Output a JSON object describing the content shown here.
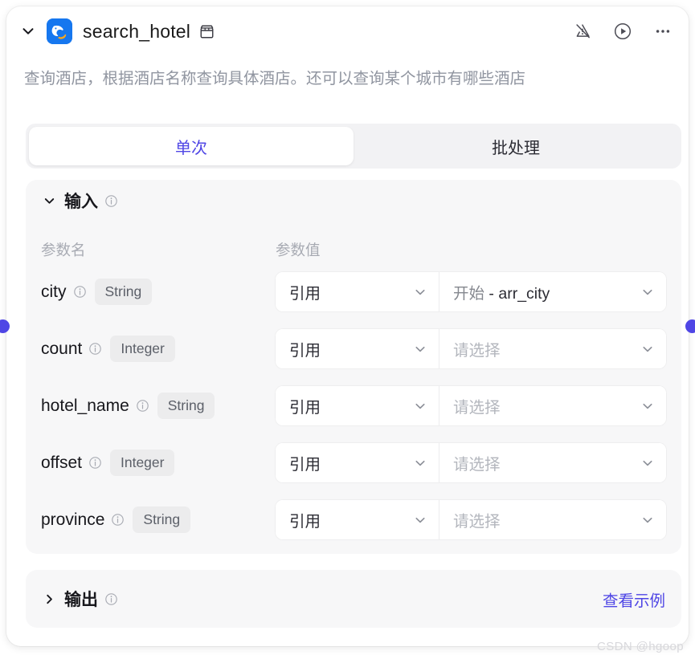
{
  "node": {
    "title": "search_hotel",
    "description": "查询酒店，根据酒店名称查询具体酒店。还可以查询某个城市有哪些酒店",
    "collapse_chevron": "chevron-down",
    "app_icon": "dolphin-app-icon",
    "store_icon": "store-icon"
  },
  "header_actions": [
    {
      "name": "mute-warning-icon",
      "label": "忽略异常"
    },
    {
      "name": "run-icon",
      "label": "运行"
    },
    {
      "name": "more-icon",
      "label": "更多"
    }
  ],
  "tabs": [
    {
      "label": "单次",
      "active": true
    },
    {
      "label": "批处理",
      "active": false
    }
  ],
  "input_section": {
    "title": "输入",
    "chevron": "chevron-down",
    "info_icon": "info-icon",
    "columns": {
      "name": "参数名",
      "value": "参数值"
    },
    "rows": [
      {
        "name": "city",
        "type": "String",
        "mode": "引用",
        "value_prefix": "开始",
        "value_separator": " - ",
        "value": "arr_city",
        "value_is_placeholder": false
      },
      {
        "name": "count",
        "type": "Integer",
        "mode": "引用",
        "value_prefix": "",
        "value_separator": "",
        "value": "请选择",
        "value_is_placeholder": true
      },
      {
        "name": "hotel_name",
        "type": "String",
        "mode": "引用",
        "value_prefix": "",
        "value_separator": "",
        "value": "请选择",
        "value_is_placeholder": true
      },
      {
        "name": "offset",
        "type": "Integer",
        "mode": "引用",
        "value_prefix": "",
        "value_separator": "",
        "value": "请选择",
        "value_is_placeholder": true
      },
      {
        "name": "province",
        "type": "String",
        "mode": "引用",
        "value_prefix": "",
        "value_separator": "",
        "value": "请选择",
        "value_is_placeholder": true
      }
    ]
  },
  "output_section": {
    "title": "输出",
    "chevron": "chevron-right",
    "info_icon": "info-icon",
    "view_example": "查看示例"
  },
  "watermark": "CSDN @hgoop",
  "colors": {
    "accent": "#4f46e5",
    "panel_bg": "#f7f7f8",
    "card_bg": "#ffffff",
    "tabbar_bg": "#f2f2f4",
    "text_primary": "#17171c",
    "text_muted": "#9095a0",
    "placeholder": "#b3b6bd",
    "tag_bg": "#ececed",
    "app_icon_bg": "#1677ef",
    "port": "#4f46e5"
  }
}
